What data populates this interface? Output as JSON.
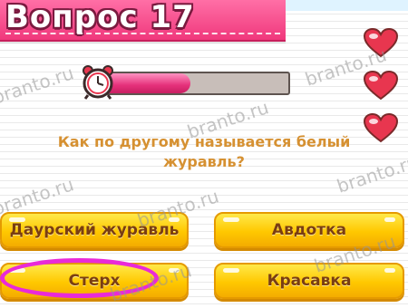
{
  "header": {
    "title": "Вопрос 17"
  },
  "lives": {
    "count": 3,
    "icon": "heart-icon"
  },
  "timer": {
    "icon": "alarm-clock-icon",
    "progress": 0.46
  },
  "question": {
    "text": "Как по другому называется белый\nжуравль?"
  },
  "answers": [
    {
      "label": "Даурский журавль"
    },
    {
      "label": "Авдотка"
    },
    {
      "label": "Стерх"
    },
    {
      "label": "Красавка"
    }
  ],
  "watermark": {
    "text": "branto.ru"
  },
  "colors": {
    "ribbon": "#f0387c",
    "answer_button": "#ffc800",
    "answer_text": "#7a3e12",
    "question_text": "#d69132",
    "highlight_circle": "#e92ad8"
  }
}
